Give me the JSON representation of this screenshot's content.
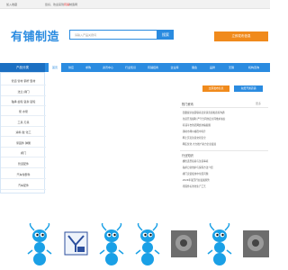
{
  "topbar": {
    "favorite": "加入收藏",
    "welcome_prefix": "您好，欢迎来到",
    "welcome_highlight": "有铺",
    "welcome_suffix": "制造网"
  },
  "header": {
    "logo_text": "有铺制造",
    "search_placeholder": "请输入产品关键词",
    "search_button": "搜索",
    "cta": "立即发布信息"
  },
  "nav": {
    "category_title": "产品分类",
    "items": [
      {
        "label": "首页",
        "active": true
      },
      {
        "label": "供应"
      },
      {
        "label": "求购"
      },
      {
        "label": "资讯中心"
      },
      {
        "label": "行业知识"
      },
      {
        "label": "有铺招商"
      },
      {
        "label": "企业库"
      },
      {
        "label": "展会"
      },
      {
        "label": "品牌"
      },
      {
        "label": "无锡"
      },
      {
        "label": "机构咨询"
      }
    ]
  },
  "sidebar": {
    "rows": [
      "管道 管材 钢杆 型材",
      "法兰 阀门",
      "轴承 齿轮 链条 链轮",
      "泵 水泵",
      "工具 刃具",
      "涂料 胶 化工",
      "紧固件 弹簧",
      "阀门",
      "管道配件",
      "汽车零部件",
      "汽车配件"
    ]
  },
  "right": {
    "publish_button": "立即发布信息",
    "free_button": "免费开通店铺",
    "news_title": "热门资讯",
    "news_more": "更多",
    "news": [
      "·温馨提示如需联系卖家请直接和商家沟通",
      "·生意开局顺利·严守合同约定共同维护诚信",
      "·有铺平台防范网络诈骗提醒",
      "·钢材市场价格稳中有升",
      "·网上买卖注意交易安全",
      "·网店优化·大力推广助力企业发展"
    ],
    "news2_title": "行业知识",
    "news2": [
      "·螺栓选型指南与注意事项",
      "·轴承日常维护与保养方法介绍",
      "·阀门安装使用中常见问题",
      "·2024年液压行业发展趋势",
      "·紧固件标准化生产工艺"
    ]
  },
  "logos": {
    "cards": [
      {
        "name": "ant",
        "color": "#1aa0e6"
      },
      {
        "name": "seal"
      },
      {
        "name": "ant",
        "color": "#1aa0e6"
      },
      {
        "name": "ant",
        "color": "#1aa0e6"
      },
      {
        "name": "photo-tools"
      },
      {
        "name": "ant",
        "color": "#1aa0e6"
      },
      {
        "name": "photo-parts"
      },
      {
        "name": "photo-machine"
      }
    ]
  }
}
